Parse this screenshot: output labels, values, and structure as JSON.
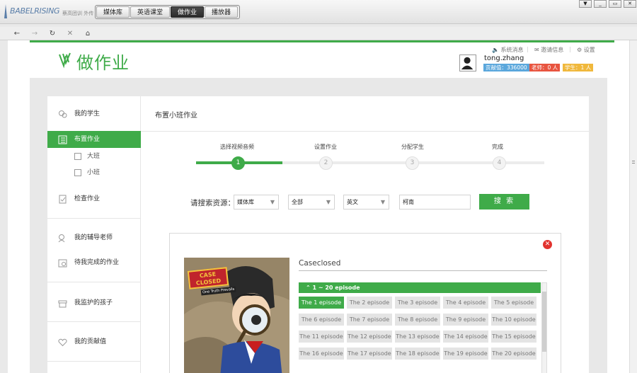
{
  "app": {
    "logo_text": "BABELRISING",
    "logo_sub": "蔡高团训 外传",
    "tabs": [
      {
        "label": "媒体库"
      },
      {
        "label": "英语课堂"
      },
      {
        "label": "做作业"
      },
      {
        "label": "播放器"
      }
    ],
    "active_tab": "做作业",
    "window_buttons": [
      "▼",
      "_",
      "▭",
      "✕"
    ]
  },
  "nav": {
    "back": "←",
    "forward": "→",
    "refresh": "↻",
    "stop": "✕",
    "home": "⌂"
  },
  "header": {
    "title": "做作业",
    "util": {
      "system_message": "系统消息",
      "invite": "邀请信息",
      "settings": "设置"
    },
    "user": {
      "name": "tong.zhang",
      "contribution": "贡献值：336000",
      "teacher": "老师：0 人",
      "student": "学生：1 人"
    }
  },
  "sidebar": {
    "items": [
      {
        "label": "我的学生",
        "icon": "students-icon"
      },
      {
        "label": "布置作业",
        "icon": "assign-homework-icon"
      },
      {
        "label": "大班",
        "icon": "class-icon"
      },
      {
        "label": "小班",
        "icon": "class-icon"
      },
      {
        "label": "检查作业",
        "icon": "check-homework-icon"
      },
      {
        "label": "我的辅导老师",
        "icon": "tutor-icon"
      },
      {
        "label": "待我完成的作业",
        "icon": "todo-icon"
      },
      {
        "label": "我监护的孩子",
        "icon": "child-icon"
      },
      {
        "label": "我的贡献值",
        "icon": "heart-icon"
      }
    ]
  },
  "main": {
    "title": "布置小班作业",
    "steps": [
      {
        "label": "选择视频音频",
        "num": "1"
      },
      {
        "label": "设置作业",
        "num": "2"
      },
      {
        "label": "分配学生",
        "num": "3"
      },
      {
        "label": "完成",
        "num": "4"
      }
    ],
    "current_step": 1,
    "search": {
      "label": "请搜索资源：",
      "source": "媒体库",
      "category": "全部",
      "language": "英文",
      "keyword": "柯南",
      "button": "搜 索"
    },
    "result": {
      "title": "Caseclosed",
      "poster_text": "CASE CLOSED",
      "poster_sub": "One Truth Prevails",
      "group_label": "1 ~ 20 episode",
      "episodes": [
        "The 1 episode",
        "The 2 episode",
        "The 3 episode",
        "The 4 episode",
        "The 5 episode",
        "The 6 episode",
        "The 7 episode",
        "The 8 episode",
        "The 9 episode",
        "The 10 episode",
        "The 11 episode",
        "The 12 episode",
        "The 13 episode",
        "The 14 episode",
        "The 15 episode",
        "The 16 episode",
        "The 17 episode",
        "The 18 episode",
        "The 19 episode",
        "The 20 episode"
      ],
      "active_episode": "The 1 episode"
    }
  },
  "colors": {
    "accent": "#3fab49",
    "badge_blue": "#5aa7dc",
    "badge_red": "#e8543f",
    "badge_yellow": "#f0b83c",
    "close": "#e2332f"
  }
}
